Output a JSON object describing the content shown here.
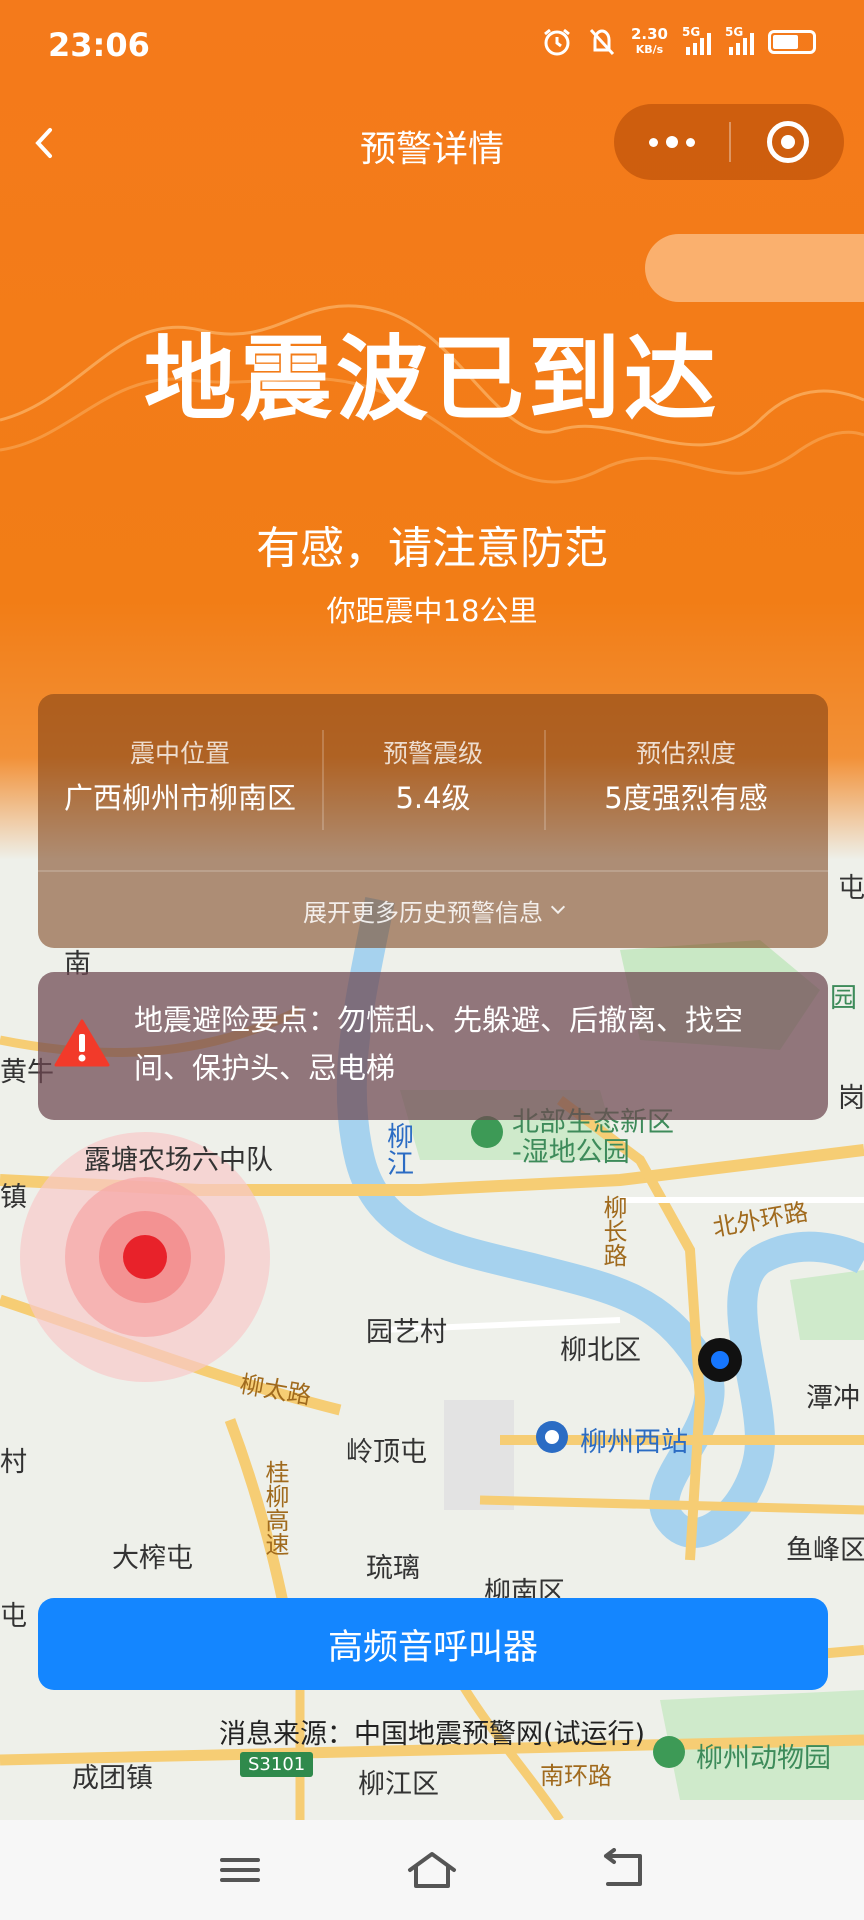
{
  "status_bar": {
    "time": "23:06",
    "net_speed_value": "2.30",
    "net_speed_unit": "KB/s",
    "sim1": "5G",
    "sim2": "5G"
  },
  "nav": {
    "title": "预警详情"
  },
  "hero": {
    "title": "地震波已到达",
    "subtitle": "有感，请注意防范",
    "distance": "你距震中18公里"
  },
  "info": {
    "location_label": "震中位置",
    "location_value": "广西柳州市柳南区",
    "magnitude_label": "预警震级",
    "magnitude_value": "5.4级",
    "intensity_label": "预估烈度",
    "intensity_value": "5度强烈有感",
    "expand_label": "展开更多历史预警信息"
  },
  "tip": {
    "text": "地震避险要点：勿慌乱、先躲避、后撤离、找空间、保护头、忌电梯"
  },
  "call_button": "高频音呼叫器",
  "source": "消息来源：中国地震预警网(试运行)",
  "map": {
    "labels": {
      "nan": "南",
      "huangniu": "黄牛",
      "zhen": "镇",
      "lutang": "露塘农场六中队",
      "liujiang": "柳江",
      "wetland_1": "北部生态新区",
      "wetland_2": "-湿地公园",
      "liuchang": "柳长路",
      "beiwai": "北外环路",
      "yuanyi": "园艺村",
      "liubei": "柳北区",
      "tanchong": "潭冲",
      "liutai": "柳太路",
      "lingding": "岭顶屯",
      "liuzhou_west": "柳州西站",
      "cun": "村",
      "hgy": "桂柳高速",
      "dazha": "大榨屯",
      "liuli": "琉璃",
      "liunan": "柳南区",
      "yufeng": "鱼峰区",
      "tun_left": "屯",
      "chengtuan": "成团镇",
      "road_badge": "S3101",
      "liujiang_qu": "柳江区",
      "nanhuan": "南环路",
      "zoo": "柳州动物园",
      "tun_right": "屯",
      "gang": "岗",
      "yuan_r": "园"
    }
  },
  "colors": {
    "header": "#f47a1b",
    "button": "#1486ff",
    "epicenter": "#e8222a",
    "user_dot": "#1677ff"
  }
}
